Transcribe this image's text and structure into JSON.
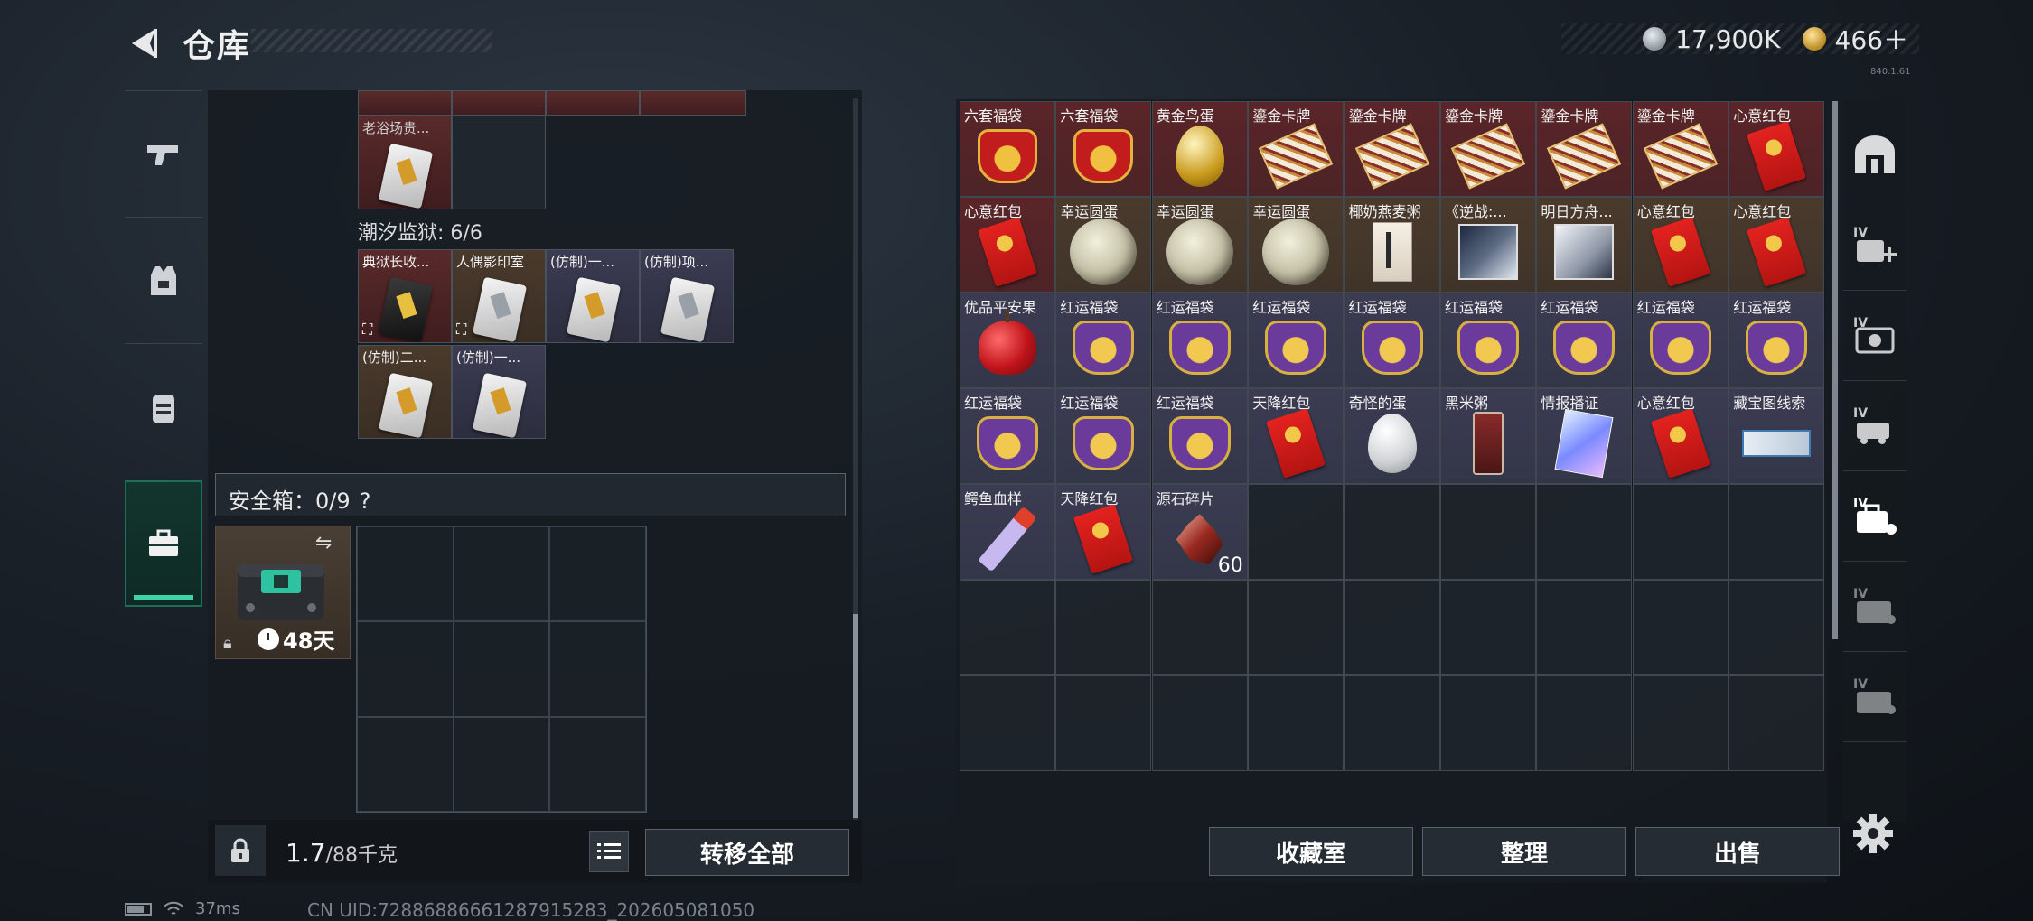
{
  "header": {
    "title": "仓库",
    "silver_amount": "17,900K",
    "gold_amount": "466＋",
    "version_text": "840.1.61"
  },
  "left_nav": {
    "tabs": [
      {
        "name": "weapons"
      },
      {
        "name": "armor"
      },
      {
        "name": "backpack"
      },
      {
        "name": "safebox"
      }
    ]
  },
  "left_panel": {
    "top_partial_item": "老浴场贵...",
    "prison_label": "潮汐监狱: 6/6",
    "prison_items": [
      "典狱长收...",
      "人偶影印室",
      "(仿制)一...",
      "(仿制)项...",
      "(仿制)二...",
      "(仿制)一..."
    ],
    "no_copy_mark": "⛶",
    "safebox_label": "安全箱：0/9",
    "safebox_help": "?",
    "safebox_timer": "48天",
    "weight_value": "1.7",
    "weight_unit": "/88千克",
    "transfer_all_label": "转移全部"
  },
  "right_panel": {
    "items": [
      {
        "label": "六套福袋",
        "icon": "lucky-bag-red",
        "bg": "#5a2528"
      },
      {
        "label": "六套福袋",
        "icon": "lucky-bag-red",
        "bg": "#5a2528"
      },
      {
        "label": "黄金鸟蛋",
        "icon": "golden-egg",
        "bg": "#5a2528"
      },
      {
        "label": "鎏金卡牌",
        "icon": "gilded-card",
        "bg": "#5a2528"
      },
      {
        "label": "鎏金卡牌",
        "icon": "gilded-card",
        "bg": "#5a2528"
      },
      {
        "label": "鎏金卡牌",
        "icon": "gilded-card",
        "bg": "#5a2528"
      },
      {
        "label": "鎏金卡牌",
        "icon": "gilded-card",
        "bg": "#5a2528"
      },
      {
        "label": "鎏金卡牌",
        "icon": "gilded-card",
        "bg": "#5a2528"
      },
      {
        "label": "心意红包",
        "icon": "red-envelope",
        "bg": "#5a2528"
      },
      {
        "label": "心意红包",
        "icon": "red-envelope",
        "bg": "#5a2528"
      },
      {
        "label": "幸运圆蛋",
        "icon": "lucky-round-egg",
        "bg": "#4a3a2c"
      },
      {
        "label": "幸运圆蛋",
        "icon": "lucky-round-egg",
        "bg": "#4a3a2c"
      },
      {
        "label": "幸运圆蛋",
        "icon": "lucky-round-egg",
        "bg": "#4a3a2c"
      },
      {
        "label": "椰奶燕麦粥",
        "icon": "book",
        "bg": "#4a3a2c"
      },
      {
        "label": "《逆战:...",
        "icon": "album-dark",
        "bg": "#4a3a2c"
      },
      {
        "label": "明日方舟...",
        "icon": "album-light",
        "bg": "#4a3a2c"
      },
      {
        "label": "心意红包",
        "icon": "red-envelope",
        "bg": "#4a3a2c"
      },
      {
        "label": "心意红包",
        "icon": "red-envelope",
        "bg": "#4a3a2c"
      },
      {
        "label": "优品平安果",
        "icon": "apple",
        "bg": "#3b3c52"
      },
      {
        "label": "红运福袋",
        "icon": "lucky-bag-purple",
        "bg": "#3b3c52"
      },
      {
        "label": "红运福袋",
        "icon": "lucky-bag-purple",
        "bg": "#3b3c52"
      },
      {
        "label": "红运福袋",
        "icon": "lucky-bag-purple",
        "bg": "#3b3c52"
      },
      {
        "label": "红运福袋",
        "icon": "lucky-bag-purple",
        "bg": "#3b3c52"
      },
      {
        "label": "红运福袋",
        "icon": "lucky-bag-purple",
        "bg": "#3b3c52"
      },
      {
        "label": "红运福袋",
        "icon": "lucky-bag-purple",
        "bg": "#3b3c52"
      },
      {
        "label": "红运福袋",
        "icon": "lucky-bag-purple",
        "bg": "#3b3c52"
      },
      {
        "label": "红运福袋",
        "icon": "lucky-bag-purple",
        "bg": "#3b3c52"
      },
      {
        "label": "红运福袋",
        "icon": "lucky-bag-purple",
        "bg": "#3b3c52"
      },
      {
        "label": "红运福袋",
        "icon": "lucky-bag-purple",
        "bg": "#3b3c52"
      },
      {
        "label": "红运福袋",
        "icon": "lucky-bag-purple",
        "bg": "#3b3c52"
      },
      {
        "label": "天降红包",
        "icon": "red-envelope",
        "bg": "#3b3c52"
      },
      {
        "label": "奇怪的蛋",
        "icon": "white-egg",
        "bg": "#3b3c52"
      },
      {
        "label": "黑米粥",
        "icon": "rice-porridge",
        "bg": "#3b3c52"
      },
      {
        "label": "情报播证",
        "icon": "intel-card",
        "bg": "#3b3c52"
      },
      {
        "label": "心意红包",
        "icon": "red-envelope",
        "bg": "#3b3c52"
      },
      {
        "label": "藏宝图线索",
        "icon": "ticket",
        "bg": "#3b3c52"
      },
      {
        "label": "鳄鱼血样",
        "icon": "test-tube",
        "bg": "#3b3c52"
      },
      {
        "label": "天降红包",
        "icon": "red-envelope",
        "bg": "#3b3c52"
      },
      {
        "label": "源石碎片",
        "icon": "shard",
        "bg": "#3b3c52",
        "count": "60"
      }
    ],
    "buttons": {
      "collection": "收藏室",
      "organize": "整理",
      "sell": "出售"
    }
  },
  "right_nav": {
    "items": [
      "shelter",
      "IV-add",
      "IV-camera",
      "IV-vehicle",
      "IV-toolbox",
      "IV-chest-a",
      "IV-chest-b"
    ],
    "tag": "IV"
  },
  "status": {
    "ping": "37ms",
    "uid": "CN UID:72886886661287915283_202605081050"
  }
}
